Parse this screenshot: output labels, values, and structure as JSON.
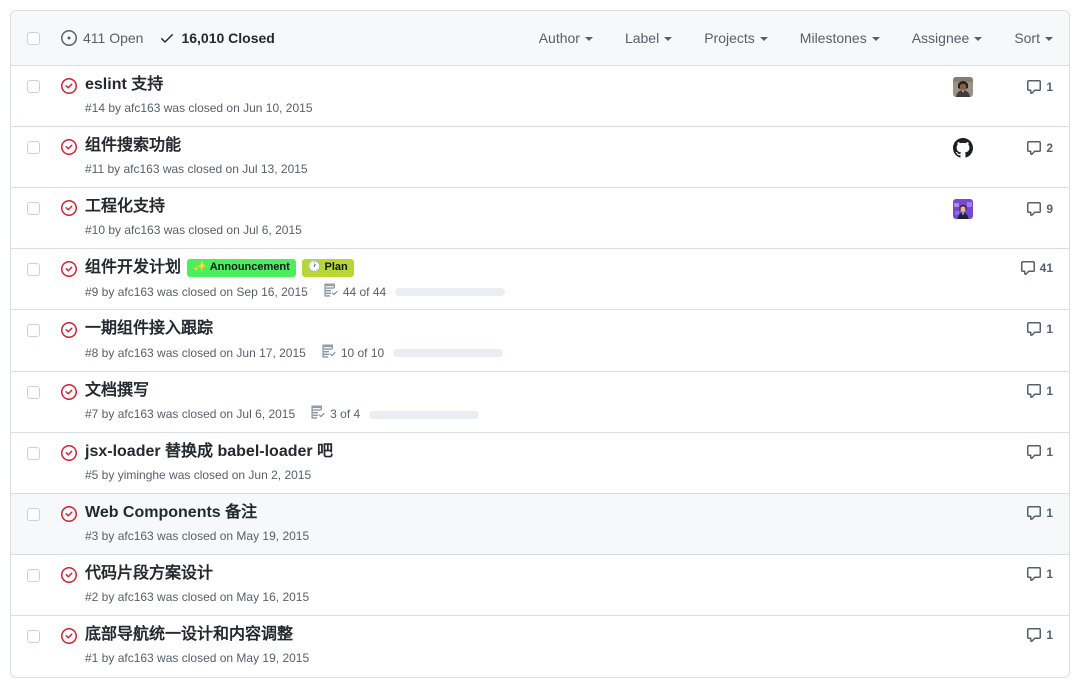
{
  "header": {
    "select_all_checkbox": "",
    "open": {
      "count": "411",
      "label": "411 Open",
      "icon": "issue-opened-icon"
    },
    "closed": {
      "count": "16,010",
      "label": "16,010 Closed",
      "icon": "check-icon"
    },
    "filters": [
      {
        "name": "author",
        "label": "Author"
      },
      {
        "name": "label",
        "label": "Label"
      },
      {
        "name": "projects",
        "label": "Projects"
      },
      {
        "name": "milestones",
        "label": "Milestones"
      },
      {
        "name": "assignee",
        "label": "Assignee"
      },
      {
        "name": "sort",
        "label": "Sort"
      }
    ]
  },
  "colors": {
    "state_icon_closed": "#cf222e",
    "border": "#d8dee4",
    "header_bg": "#f6f8fa",
    "row_highlight_bg": "#f6f8fa",
    "title_text": "#24292f",
    "meta_text": "#57606a",
    "progress_track": "#eaeef2",
    "progress_fill": "#afb8c1",
    "label_announcement_bg": "#4bee5c",
    "label_announcement_text": "#11161b",
    "label_plan_bg": "#b8d831",
    "label_plan_text": "#11161b"
  },
  "issues": [
    {
      "title": "eslint 支持",
      "state_icon": "issue-closed-icon",
      "meta": "#14 by afc163 was closed on Jun 10, 2015",
      "labels": [],
      "tasks": null,
      "avatar": "photo-dark-hair",
      "comments": "1",
      "highlight": false
    },
    {
      "title": "组件搜索功能",
      "state_icon": "issue-closed-icon",
      "meta": "#11 by afc163 was closed on Jul 13, 2015",
      "labels": [],
      "tasks": null,
      "avatar": "octocat",
      "comments": "2",
      "highlight": false
    },
    {
      "title": "工程化支持",
      "state_icon": "issue-closed-icon",
      "meta": "#10 by afc163 was closed on Jul 6, 2015",
      "labels": [],
      "tasks": null,
      "avatar": "photo-purple",
      "comments": "9",
      "highlight": false
    },
    {
      "title": "组件开发计划",
      "state_icon": "issue-closed-icon",
      "meta": "#9 by afc163 was closed on Sep 16, 2015",
      "labels": [
        {
          "name": "announcement",
          "emoji": "✨",
          "text": "Announcement",
          "bg": "#4bee5c",
          "fg": "#11161b"
        },
        {
          "name": "plan",
          "emoji": "🕐",
          "text": "Plan",
          "bg": "#b8d831",
          "fg": "#11161b"
        }
      ],
      "tasks": {
        "text": "44 of 44",
        "done": 44,
        "total": 44,
        "percent": 100
      },
      "avatar": null,
      "comments": "41",
      "highlight": false
    },
    {
      "title": "一期组件接入跟踪",
      "state_icon": "issue-closed-icon",
      "meta": "#8 by afc163 was closed on Jun 17, 2015",
      "labels": [],
      "tasks": {
        "text": "10 of 10",
        "done": 10,
        "total": 10,
        "percent": 100
      },
      "avatar": null,
      "comments": "1",
      "highlight": false
    },
    {
      "title": "文档撰写",
      "state_icon": "issue-closed-icon",
      "meta": "#7 by afc163 was closed on Jul 6, 2015",
      "labels": [],
      "tasks": {
        "text": "3 of 4",
        "done": 3,
        "total": 4,
        "percent": 75
      },
      "avatar": null,
      "comments": "1",
      "highlight": false
    },
    {
      "title": "jsx-loader 替换成 babel-loader 吧",
      "state_icon": "issue-closed-icon",
      "meta": "#5 by yiminghe was closed on Jun 2, 2015",
      "labels": [],
      "tasks": null,
      "avatar": null,
      "comments": "1",
      "highlight": false
    },
    {
      "title": "Web Components 备注",
      "state_icon": "issue-closed-icon",
      "meta": "#3 by afc163 was closed on May 19, 2015",
      "labels": [],
      "tasks": null,
      "avatar": null,
      "comments": "1",
      "highlight": true
    },
    {
      "title": "代码片段方案设计",
      "state_icon": "issue-closed-icon",
      "meta": "#2 by afc163 was closed on May 16, 2015",
      "labels": [],
      "tasks": null,
      "avatar": null,
      "comments": "1",
      "highlight": false
    },
    {
      "title": "底部导航统一设计和内容调整",
      "state_icon": "issue-closed-icon",
      "meta": "#1 by afc163 was closed on May 19, 2015",
      "labels": [],
      "tasks": null,
      "avatar": null,
      "comments": "1",
      "highlight": false
    }
  ]
}
